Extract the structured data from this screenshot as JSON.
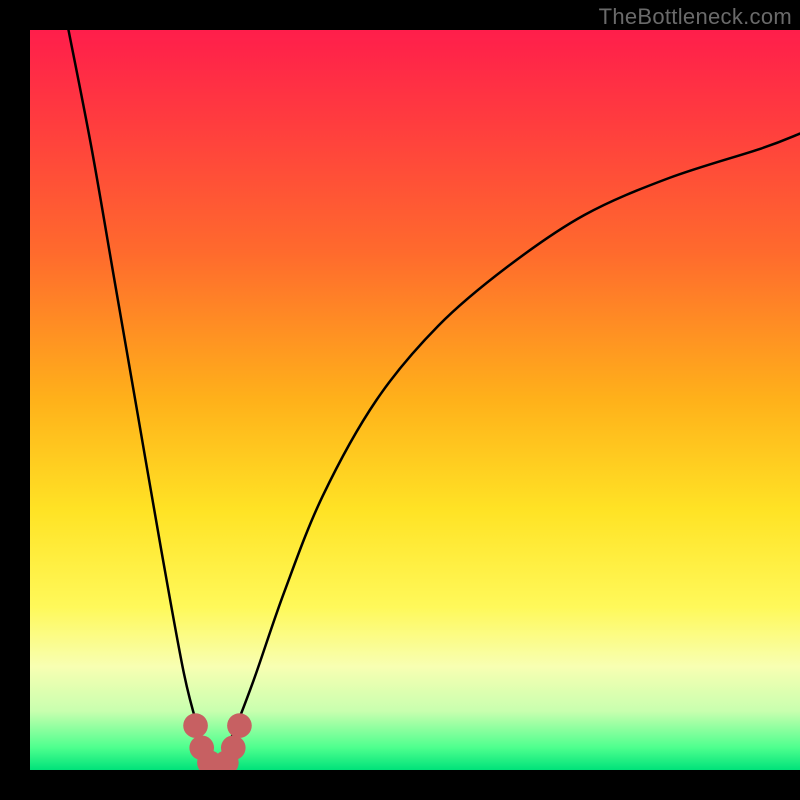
{
  "watermark": "TheBottleneck.com",
  "colors": {
    "black": "#000000",
    "marker": "#c76062",
    "curve": "#000000",
    "gradient_stops": [
      {
        "offset": 0.0,
        "color": "#ff1e4b"
      },
      {
        "offset": 0.12,
        "color": "#ff3b3f"
      },
      {
        "offset": 0.3,
        "color": "#ff6a2d"
      },
      {
        "offset": 0.5,
        "color": "#ffb11a"
      },
      {
        "offset": 0.65,
        "color": "#ffe325"
      },
      {
        "offset": 0.78,
        "color": "#fff95a"
      },
      {
        "offset": 0.86,
        "color": "#f8ffb2"
      },
      {
        "offset": 0.92,
        "color": "#c9ffaf"
      },
      {
        "offset": 0.97,
        "color": "#4dff8e"
      },
      {
        "offset": 1.0,
        "color": "#00e27a"
      }
    ]
  },
  "chart_data": {
    "type": "line",
    "title": "",
    "xlabel": "",
    "ylabel": "",
    "xlim": [
      0,
      100
    ],
    "ylim": [
      0,
      100
    ],
    "series": [
      {
        "name": "bottleneck-curve-left",
        "x": [
          5,
          8,
          11,
          14,
          17,
          20,
          22,
          23,
          24
        ],
        "y": [
          100,
          84,
          66,
          48,
          30,
          13,
          5,
          2,
          0
        ]
      },
      {
        "name": "bottleneck-curve-right",
        "x": [
          24,
          26,
          29,
          33,
          38,
          45,
          53,
          62,
          72,
          83,
          95,
          100
        ],
        "y": [
          0,
          4,
          12,
          24,
          37,
          50,
          60,
          68,
          75,
          80,
          84,
          86
        ]
      }
    ],
    "markers": {
      "name": "sweet-spot",
      "points": [
        {
          "x": 21.5,
          "y": 6
        },
        {
          "x": 22.3,
          "y": 3
        },
        {
          "x": 23.3,
          "y": 1
        },
        {
          "x": 25.5,
          "y": 1
        },
        {
          "x": 26.4,
          "y": 3
        },
        {
          "x": 27.2,
          "y": 6
        }
      ],
      "radius_pct": 1.6
    }
  }
}
